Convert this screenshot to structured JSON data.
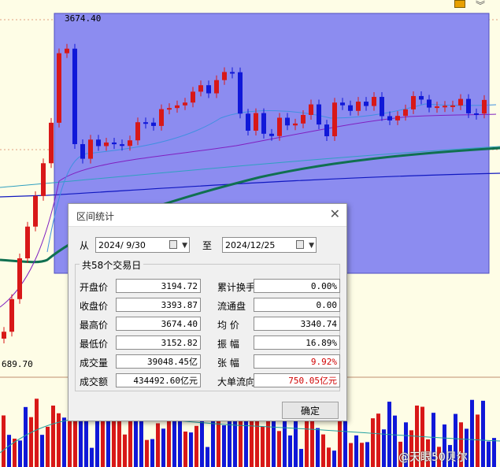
{
  "chart": {
    "high_label": "3674.40",
    "low_label": "689.70",
    "selection_color": "#8c8cf0",
    "up_color": "#d81818",
    "down_color": "#1018d8",
    "flat_color": "#c01878"
  },
  "dialog": {
    "title": "区间统计",
    "from_label": "从",
    "from_date": "2024/ 9/30",
    "to_label": "至",
    "to_date": "2024/12/25",
    "group_label": "共58个交易日",
    "ok_label": "确定",
    "rows": [
      {
        "llabel": "开盘价",
        "lvalue": "3194.72",
        "rlabel": "累计换手率",
        "rvalue": "0.00%",
        "rred": false
      },
      {
        "llabel": "收盘价",
        "lvalue": "3393.87",
        "rlabel": "流通盘",
        "rvalue": "0.00",
        "rred": false
      },
      {
        "llabel": "最高价",
        "lvalue": "3674.40",
        "rlabel": "均  价",
        "rvalue": "3340.74",
        "rred": false
      },
      {
        "llabel": "最低价",
        "lvalue": "3152.82",
        "rlabel": "振  幅",
        "rvalue": "16.89%",
        "rred": false
      },
      {
        "llabel": "成交量",
        "lvalue": "39048.45亿",
        "rlabel": "张  幅",
        "rvalue": "9.92%",
        "rred": true
      },
      {
        "llabel": "成交额",
        "lvalue": "434492.60亿元",
        "rlabel": "大单流向",
        "rvalue": "750.05亿元",
        "rred": true
      }
    ]
  },
  "watermark": "@天眼50贝尔"
}
